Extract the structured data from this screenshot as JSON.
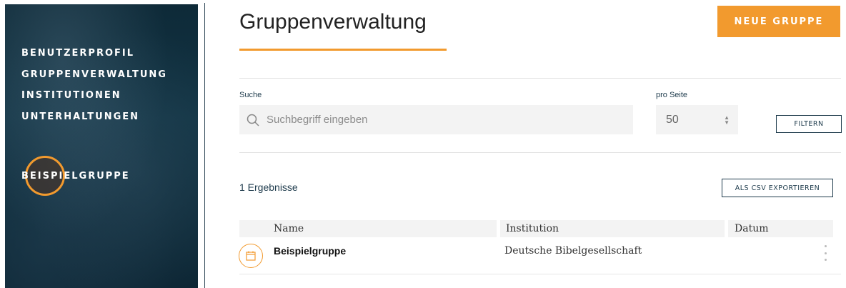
{
  "sidebar": {
    "nav_items": [
      {
        "label": "BENUTZERPROFIL"
      },
      {
        "label": "GRUPPENVERWALTUNG"
      },
      {
        "label": "INSTITUTIONEN"
      },
      {
        "label": "UNTERHALTUNGEN"
      }
    ],
    "group_label": "BEISPIELGRUPPE"
  },
  "header": {
    "title": "Gruppenverwaltung",
    "new_group_button": "NEUE GRUPPE"
  },
  "search": {
    "label": "Suche",
    "placeholder": "Suchbegriff eingeben",
    "value": ""
  },
  "per_page": {
    "label": "pro Seite",
    "value": "50"
  },
  "filter_button": "FILTERN",
  "results": {
    "count_text": "1 Ergebnisse",
    "export_button": "ALS CSV EXPORTIEREN"
  },
  "table": {
    "columns": [
      "Name",
      "Institution",
      "Datum"
    ],
    "rows": [
      {
        "name": "Beispielgruppe",
        "institution": "Deutsche Bibelgesellschaft",
        "date": ""
      }
    ]
  },
  "colors": {
    "accent": "#f29a2e",
    "dark_text": "#1e3b4c",
    "sidebar_bg": "#123444"
  },
  "icons": {
    "search": "search-icon",
    "row": "calendar-icon",
    "row_menu": "more-vertical-icon"
  }
}
